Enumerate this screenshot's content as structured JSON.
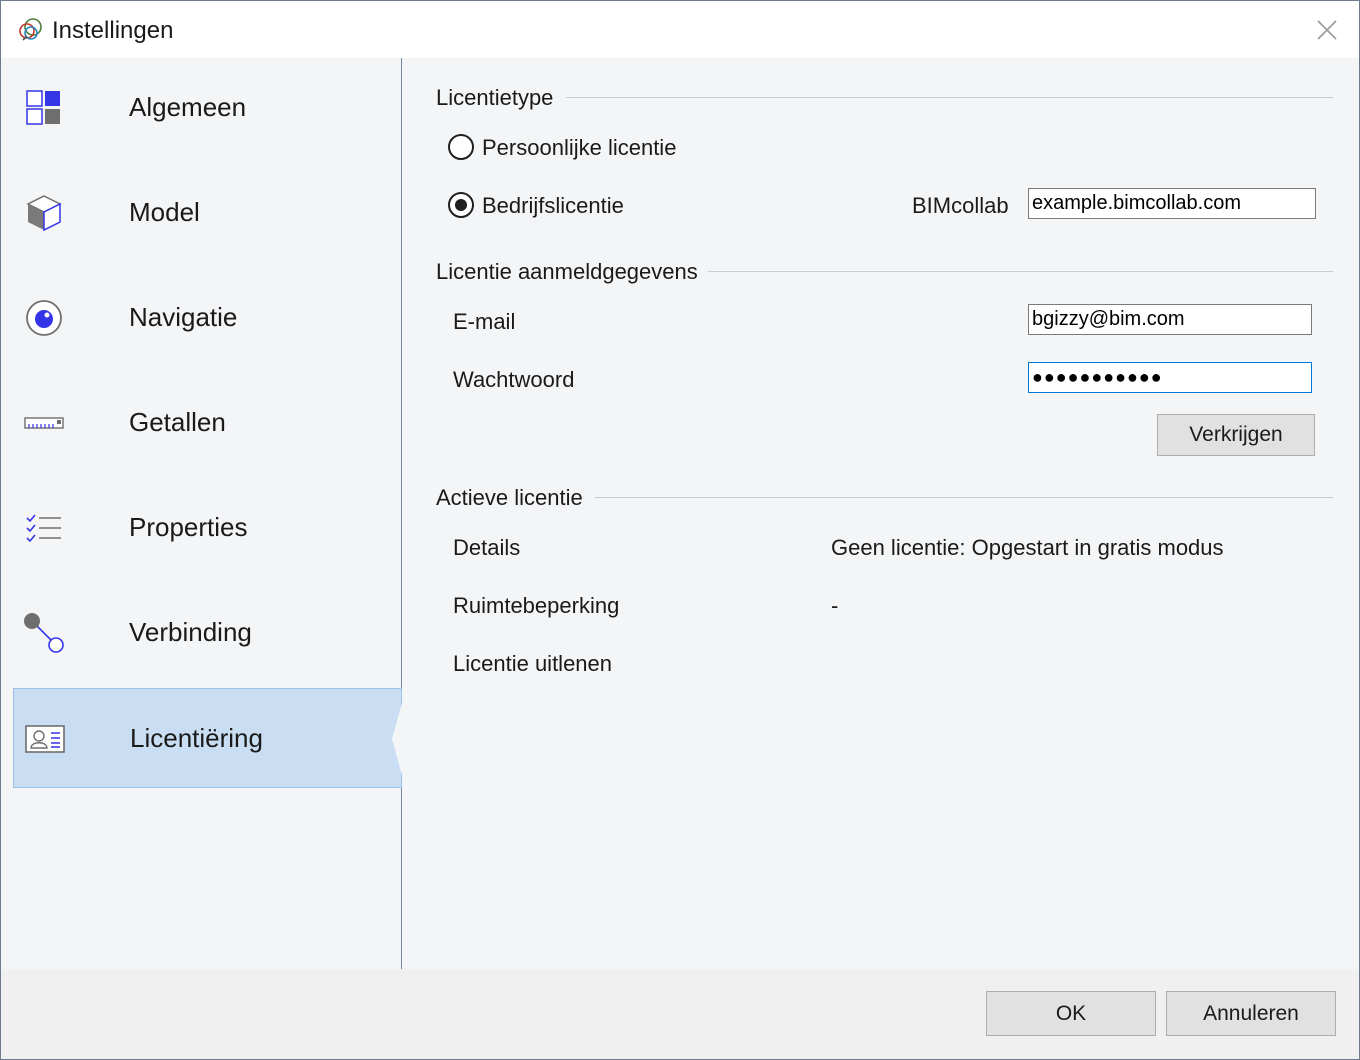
{
  "window": {
    "title": "Instellingen"
  },
  "sidebar": {
    "items": [
      {
        "label": "Algemeen",
        "icon": "grid-icon"
      },
      {
        "label": "Model",
        "icon": "cube-icon"
      },
      {
        "label": "Navigatie",
        "icon": "eye-icon"
      },
      {
        "label": "Getallen",
        "icon": "ruler-icon"
      },
      {
        "label": "Properties",
        "icon": "checklist-icon"
      },
      {
        "label": "Verbinding",
        "icon": "connection-icon"
      },
      {
        "label": "Licentiëring",
        "icon": "id-card-icon",
        "active": true
      }
    ]
  },
  "license_type": {
    "heading": "Licentietype",
    "personal_label": "Persoonlijke licentie",
    "personal_selected": false,
    "company_label": "Bedrijfslicentie",
    "company_selected": true,
    "bimcollab_label": "BIMcollab",
    "bimcollab_value": "example.bimcollab.com"
  },
  "credentials": {
    "heading": "Licentie aanmeldgegevens",
    "email_label": "E-mail",
    "email_value": "bgizzy@bim.com",
    "password_label": "Wachtwoord",
    "password_value": "●●●●●●●●●●●",
    "obtain_button": "Verkrijgen"
  },
  "active_license": {
    "heading": "Actieve licentie",
    "details_label": "Details",
    "details_value": "Geen licentie: Opgestart in gratis modus",
    "space_label": "Ruimtebeperking",
    "space_value": "-",
    "lend_label": "Licentie uitlenen"
  },
  "footer": {
    "ok_label": "OK",
    "cancel_label": "Annuleren"
  },
  "colors": {
    "accent": "#3535e8",
    "active_bg": "#c9def3",
    "focus": "#0078d7"
  }
}
